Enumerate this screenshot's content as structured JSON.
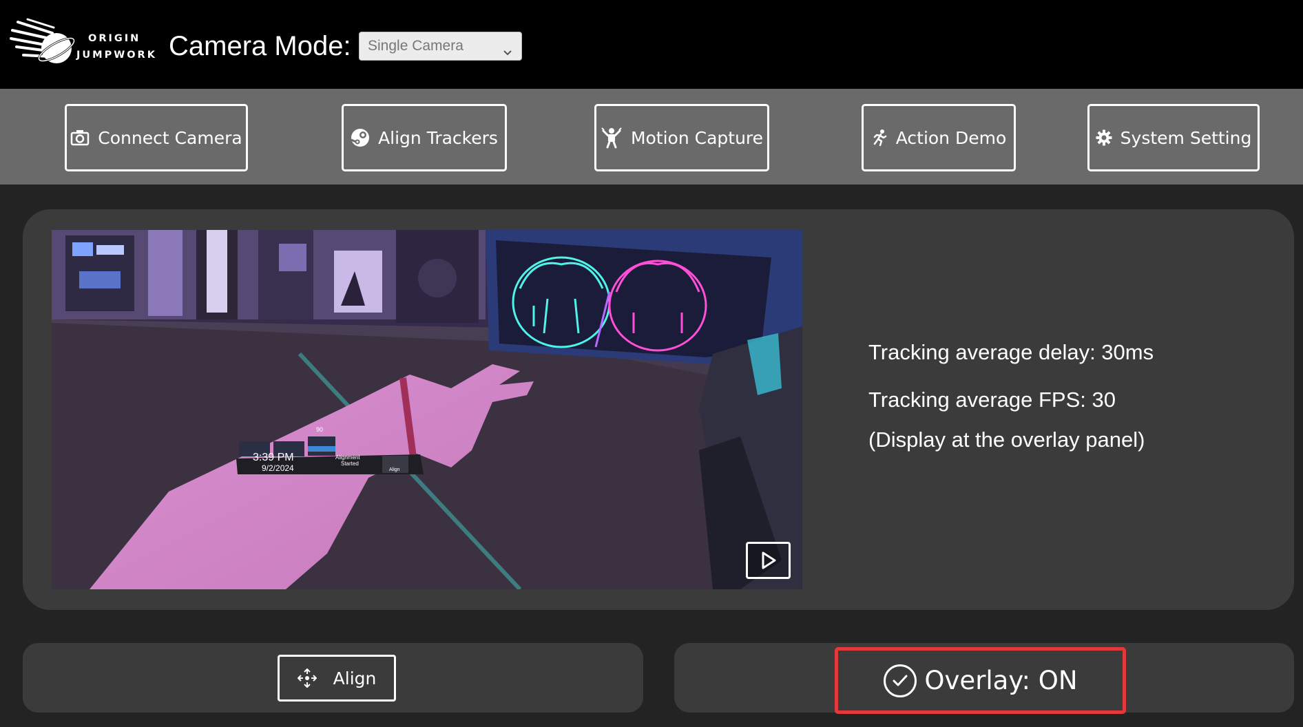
{
  "app": {
    "logo_line1": "ORIGIN",
    "logo_line2": "JUMPWORK",
    "camera_mode_label": "Camera Mode:",
    "camera_mode_value": "Single Camera"
  },
  "toolbar": {
    "items": [
      {
        "label": "Connect Camera",
        "icon": "camera-icon"
      },
      {
        "label": "Align Trackers",
        "icon": "steam-icon"
      },
      {
        "label": "Motion Capture",
        "icon": "motion-figure-icon"
      },
      {
        "label": "Action Demo",
        "icon": "running-figure-icon"
      },
      {
        "label": "System Setting",
        "icon": "gear-icon"
      }
    ]
  },
  "preview": {
    "wrist_time": "3:39 PM",
    "wrist_date": "9/2/2024",
    "wrist_status_line1": "Alignment",
    "wrist_status_line2": "Started",
    "wrist_align_label": "Align",
    "wrist_badge": "90"
  },
  "stats": {
    "delay": "Tracking average delay: 30ms",
    "fps": "Tracking average FPS: 30",
    "note": "(Display at the overlay panel)"
  },
  "bottom": {
    "align_label": "Align",
    "overlay_label": "Overlay: ON"
  },
  "colors": {
    "header_bg": "#000000",
    "toolbar_bg": "#6a6a6a",
    "page_bg": "#232323",
    "panel_bg": "#3b3b3b",
    "highlight": "#e5383b"
  }
}
